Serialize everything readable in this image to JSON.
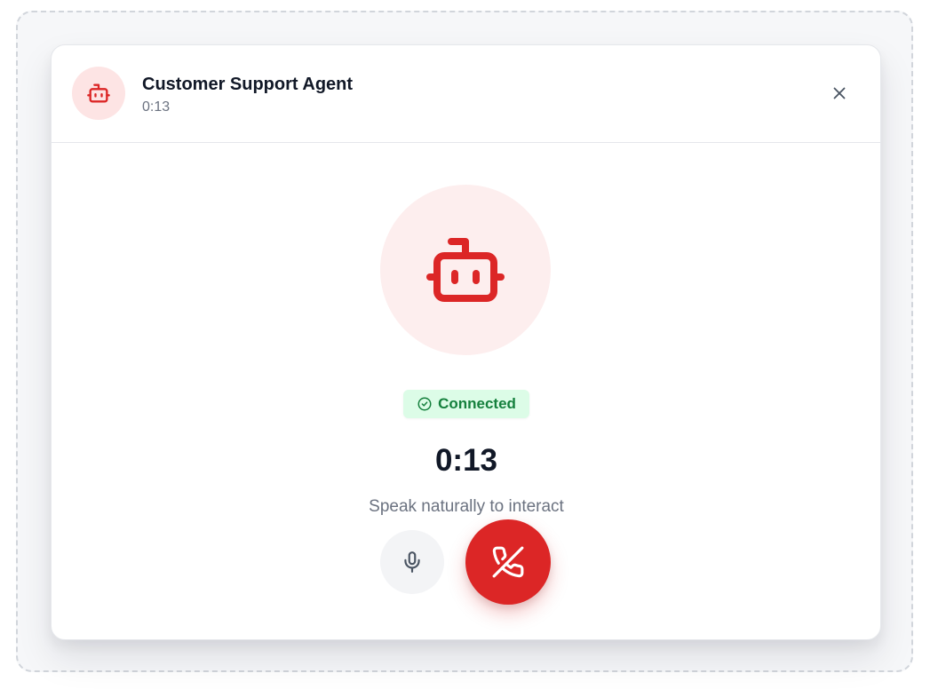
{
  "call": {
    "agent_name": "Customer Support Agent",
    "header_timer": "0:13",
    "status_label": "Connected",
    "main_timer": "0:13",
    "hint": "Speak naturally to interact"
  },
  "icons": {
    "header_avatar": "bot-icon",
    "close": "close-icon",
    "main_avatar": "bot-icon",
    "status": "check-circle-icon",
    "mic": "microphone-icon",
    "hangup": "phone-off-icon"
  },
  "colors": {
    "accent_red": "#dc2626",
    "avatar_bg": "#fde4e4",
    "status_bg": "#dcfce7",
    "status_text": "#15803d",
    "muted_text": "#6b7280"
  }
}
